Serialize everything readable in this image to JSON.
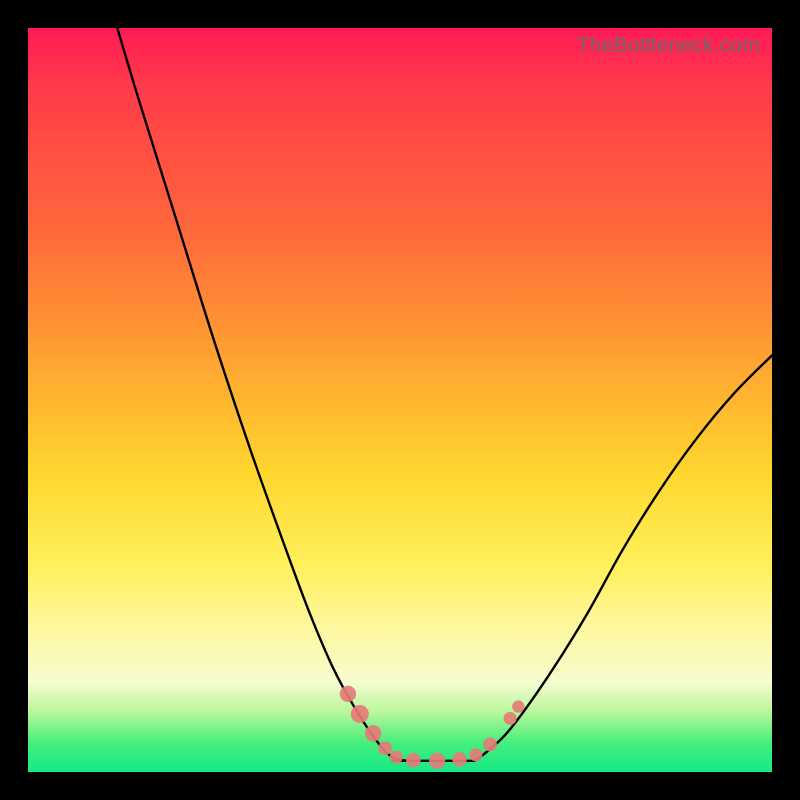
{
  "watermark": {
    "text": "TheBottleneck.com"
  },
  "colors": {
    "frame": "#000000",
    "gradient_top": "#ff1a56",
    "gradient_mid": "#ffd72f",
    "gradient_bottom": "#13e986",
    "curve": "#000000",
    "marker": "#e67b78"
  },
  "chart_data": {
    "type": "line",
    "title": "",
    "xlabel": "",
    "ylabel": "",
    "xlim": [
      0,
      100
    ],
    "ylim": [
      0,
      100
    ],
    "grid": false,
    "legend": false,
    "series": [
      {
        "name": "left-curve",
        "x": [
          12,
          15,
          20,
          25,
          30,
          35,
          38,
          41,
          44,
          47,
          49,
          51
        ],
        "y": [
          100,
          90,
          74,
          58,
          43,
          29,
          21,
          14,
          8.5,
          4,
          2,
          1.5
        ]
      },
      {
        "name": "right-curve",
        "x": [
          60,
          62,
          65,
          70,
          75,
          80,
          85,
          90,
          95,
          100
        ],
        "y": [
          1.5,
          3,
          6,
          13,
          21,
          30,
          38,
          45,
          51,
          56
        ]
      },
      {
        "name": "floor",
        "x": [
          49,
          60
        ],
        "y": [
          1.5,
          1.5
        ]
      }
    ],
    "markers": [
      {
        "name": "left-dot-a",
        "x": 43.0,
        "y": 10.5,
        "size": 2.0
      },
      {
        "name": "left-dot-b",
        "x": 44.6,
        "y": 7.8,
        "size": 2.2
      },
      {
        "name": "left-dot-c",
        "x": 46.4,
        "y": 5.2,
        "size": 2.0
      },
      {
        "name": "left-dot-d",
        "x": 48.0,
        "y": 3.2,
        "size": 1.7
      },
      {
        "name": "floor-dot-a",
        "x": 49.5,
        "y": 2.0,
        "size": 1.6
      },
      {
        "name": "floor-dot-b",
        "x": 51.8,
        "y": 1.6,
        "size": 1.8
      },
      {
        "name": "floor-dot-c",
        "x": 55.0,
        "y": 1.5,
        "size": 2.0
      },
      {
        "name": "floor-dot-d",
        "x": 58.0,
        "y": 1.7,
        "size": 1.8
      },
      {
        "name": "right-dot-a",
        "x": 60.2,
        "y": 2.3,
        "size": 1.6
      },
      {
        "name": "right-dot-b",
        "x": 62.1,
        "y": 3.7,
        "size": 1.7
      },
      {
        "name": "right-dot-c",
        "x": 64.8,
        "y": 7.2,
        "size": 1.6
      },
      {
        "name": "right-dot-d",
        "x": 65.9,
        "y": 8.8,
        "size": 1.5
      }
    ]
  }
}
